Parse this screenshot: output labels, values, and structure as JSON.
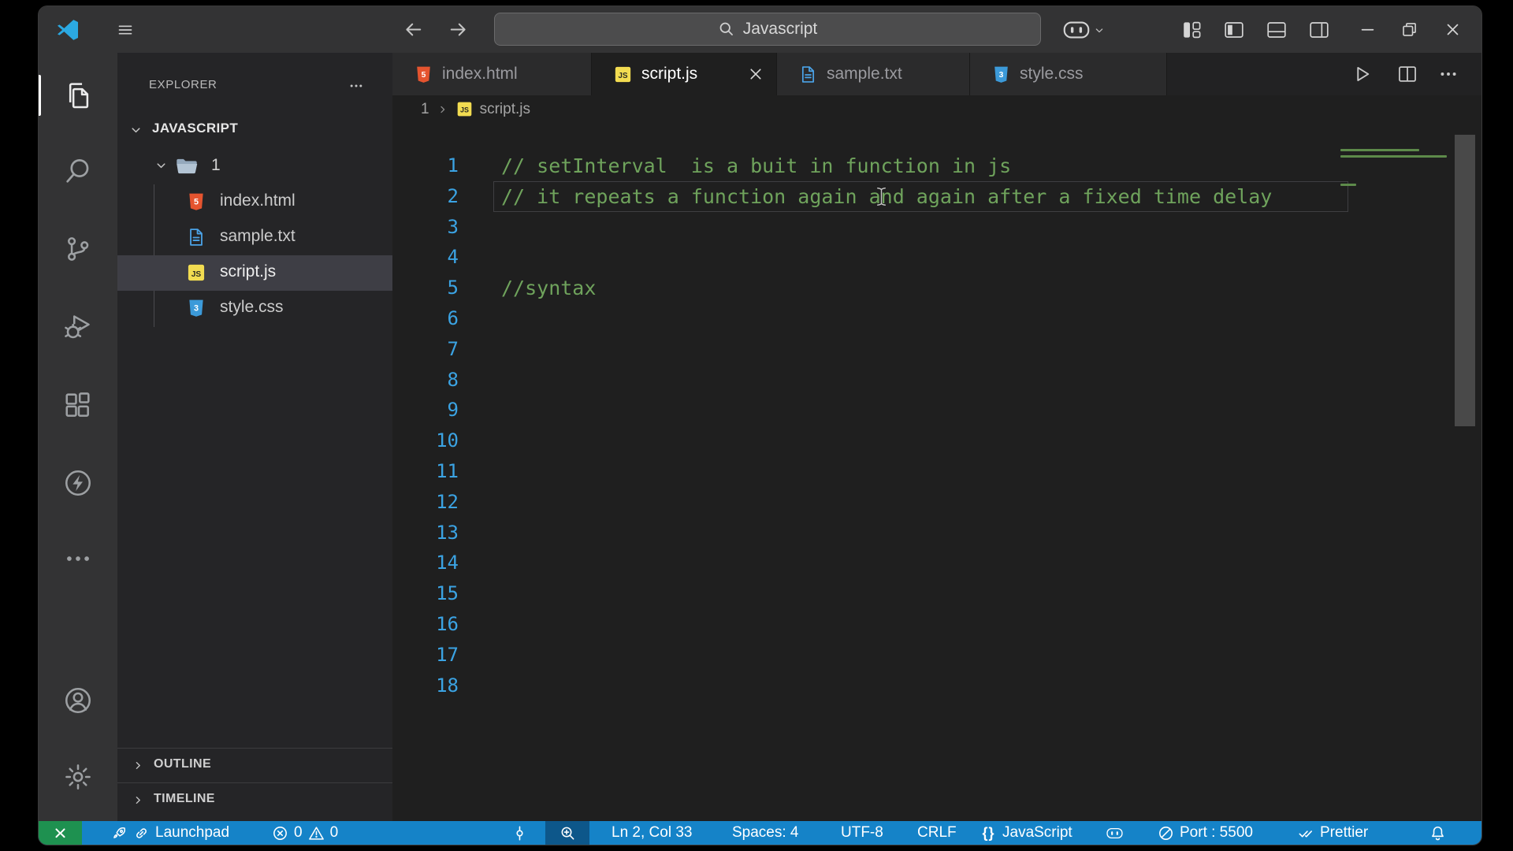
{
  "titlebar": {
    "search_value": "Javascript",
    "icons": [
      "vscode-logo",
      "menu",
      "back",
      "forward",
      "search",
      "copilot",
      "chevron-down",
      "customize-layout",
      "toggle-sidebar",
      "toggle-panel",
      "toggle-secondary-sidebar",
      "minimize",
      "restore",
      "close"
    ]
  },
  "activity_bar": {
    "items": [
      {
        "id": "explorer",
        "icon": "files",
        "active": true
      },
      {
        "id": "search",
        "icon": "search-big",
        "active": false
      },
      {
        "id": "source-control",
        "icon": "source-control",
        "active": false
      },
      {
        "id": "run-debug",
        "icon": "run-debug",
        "active": false
      },
      {
        "id": "extensions",
        "icon": "extensions",
        "active": false
      },
      {
        "id": "thunder-client",
        "icon": "thunder",
        "active": false
      },
      {
        "id": "more",
        "icon": "more",
        "active": false
      }
    ],
    "bottom_items": [
      {
        "id": "account",
        "icon": "account"
      },
      {
        "id": "settings",
        "icon": "gear"
      }
    ]
  },
  "sidebar": {
    "title": "EXPLORER",
    "workspace": {
      "label": "JAVASCRIPT",
      "expanded": true
    },
    "folder": {
      "label": "1",
      "expanded": true
    },
    "files": [
      {
        "label": "index.html",
        "icon": "html-file",
        "selected": false
      },
      {
        "label": "sample.txt",
        "icon": "txt-file",
        "selected": false
      },
      {
        "label": "script.js",
        "icon": "js-file",
        "selected": true
      },
      {
        "label": "style.css",
        "icon": "css-file",
        "selected": false
      }
    ],
    "sections": [
      {
        "label": "OUTLINE"
      },
      {
        "label": "TIMELINE"
      }
    ]
  },
  "tabs": [
    {
      "label": "index.html",
      "icon": "html-file",
      "active": false
    },
    {
      "label": "script.js",
      "icon": "js-file",
      "active": true
    },
    {
      "label": "sample.txt",
      "icon": "txt-file",
      "active": false
    },
    {
      "label": "style.css",
      "icon": "css-file",
      "active": false
    }
  ],
  "editor_actions": [
    {
      "id": "run",
      "icon": "run"
    },
    {
      "id": "split-editor",
      "icon": "split"
    },
    {
      "id": "more-actions",
      "icon": "more"
    }
  ],
  "breadcrumb": {
    "folder": "1",
    "file": "script.js",
    "file_icon": "js-file"
  },
  "editor": {
    "total_lines": 18,
    "lines": {
      "1": "// setInterval  is a buit in function in js",
      "2": "// it repeats a function again and again after a fixed time delay",
      "5": "//syntax"
    },
    "cursor": {
      "line": 2,
      "col": 33
    }
  },
  "status_bar": {
    "items": [
      {
        "id": "remote",
        "parts": [
          {
            "icon": "remote"
          }
        ]
      },
      {
        "id": "launchpad",
        "parts": [
          {
            "icon": "rocket"
          },
          {
            "icon": "link"
          },
          {
            "text": "Launchpad"
          }
        ]
      },
      {
        "id": "problems",
        "parts": [
          {
            "icon": "error"
          },
          {
            "text": "0"
          },
          {
            "icon": "warning"
          },
          {
            "text": "0"
          }
        ]
      },
      {
        "id": "screencast",
        "parts": [
          {
            "icon": "commit"
          }
        ]
      },
      {
        "id": "zoom",
        "parts": [
          {
            "icon": "zoom-in"
          }
        ]
      },
      {
        "id": "cursor-position",
        "parts": [
          {
            "text": "Ln 2, Col 33"
          }
        ]
      },
      {
        "id": "indentation",
        "parts": [
          {
            "text": "Spaces: 4"
          }
        ]
      },
      {
        "id": "encoding",
        "parts": [
          {
            "text": "UTF-8"
          }
        ]
      },
      {
        "id": "eol",
        "parts": [
          {
            "text": "CRLF"
          }
        ]
      },
      {
        "id": "language",
        "parts": [
          {
            "icon": "braces"
          },
          {
            "text": "JavaScript"
          }
        ]
      },
      {
        "id": "copilot",
        "parts": [
          {
            "icon": "copilot"
          }
        ]
      },
      {
        "id": "port",
        "parts": [
          {
            "icon": "blocked"
          },
          {
            "text": "Port : 5500"
          }
        ]
      },
      {
        "id": "prettier",
        "parts": [
          {
            "icon": "double-check"
          },
          {
            "text": "Prettier"
          }
        ]
      },
      {
        "id": "notifications",
        "parts": [
          {
            "icon": "bell"
          }
        ]
      }
    ]
  },
  "colors": {
    "titlebar": "#333334",
    "activity_bar": "#333334",
    "sidebar": "#252527",
    "editor_bg": "#1f1f1f",
    "selection_row": "#3e3e45",
    "status_bar_blue": "#1583c8",
    "remote_green": "#1e9150",
    "comment_green": "#6fa35c",
    "line_number_blue": "#3ba3e3",
    "js_yellow": "#f2dc51",
    "html_orange": "#e5542f",
    "css_blue": "#3c9ad9"
  }
}
